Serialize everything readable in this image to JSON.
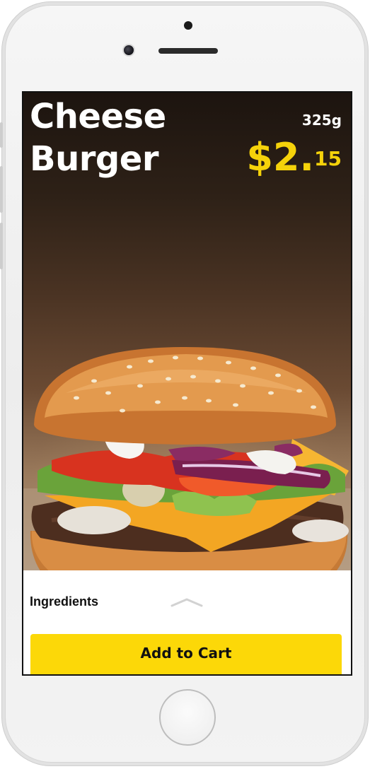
{
  "product": {
    "title_line1": "Cheese",
    "title_line2": "Burger",
    "weight": "325g",
    "price_main": "$2.",
    "price_cents": "15"
  },
  "details": {
    "ingredients_label": "Ingredients",
    "expand_icon": "chevron-up-icon"
  },
  "actions": {
    "add_to_cart_label": "Add to Cart"
  },
  "colors": {
    "accent": "#fcd808",
    "price": "#f5d20a",
    "title": "#ffffff"
  }
}
